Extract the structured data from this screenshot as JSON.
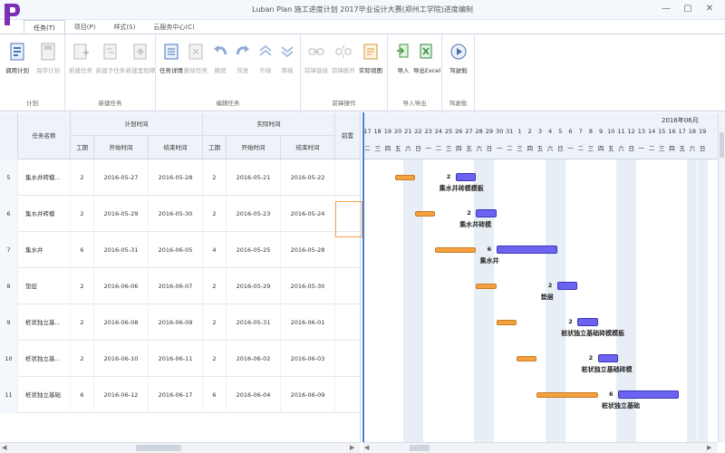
{
  "window": {
    "title": "Luban Plan 施工进度计划 2017毕业设计大赛(郑州工学院)进度编制",
    "minimize": "—",
    "maximize": "▢",
    "close": "✕"
  },
  "tabs": [
    "任务(T)",
    "项目(P)",
    "样式(S)",
    "云服务中心(C)"
  ],
  "ribbon": {
    "groups": [
      {
        "label": "计划",
        "buttons": [
          {
            "label": "调用计划",
            "icon": "open-plan-icon",
            "enabled": true
          },
          {
            "label": "保存计划",
            "icon": "save-plan-icon",
            "enabled": false
          }
        ]
      },
      {
        "label": "新建任务",
        "buttons": [
          {
            "label": "新建任务",
            "icon": "new-task-icon",
            "enabled": false
          },
          {
            "label": "新建子任务",
            "icon": "new-subtask-icon",
            "enabled": false
          },
          {
            "label": "新建里程碑",
            "icon": "new-milestone-icon",
            "enabled": false
          }
        ]
      },
      {
        "label": "编辑任务",
        "buttons": [
          {
            "label": "任务详情",
            "icon": "task-detail-icon",
            "enabled": true
          },
          {
            "label": "删除任务",
            "icon": "delete-task-icon",
            "enabled": false
          },
          {
            "label": "撤销",
            "icon": "undo-icon",
            "enabled": false
          },
          {
            "label": "恢复",
            "icon": "redo-icon",
            "enabled": false
          },
          {
            "label": "升级",
            "icon": "upgrade-icon",
            "enabled": false
          },
          {
            "label": "降级",
            "icon": "downgrade-icon",
            "enabled": false
          }
        ]
      },
      {
        "label": "前锋操作",
        "buttons": [
          {
            "label": "前锋链接",
            "icon": "link-icon",
            "enabled": false
          },
          {
            "label": "前锋断开",
            "icon": "unlink-icon",
            "enabled": false
          },
          {
            "label": "实际视图",
            "icon": "actual-view-icon",
            "enabled": true
          }
        ]
      },
      {
        "label": "导入导出",
        "buttons": [
          {
            "label": "导入",
            "icon": "import-icon",
            "enabled": true
          },
          {
            "label": "导出Excel",
            "icon": "export-excel-icon",
            "enabled": true
          }
        ]
      },
      {
        "label": "驾驶舱",
        "buttons": [
          {
            "label": "驾驶舱",
            "icon": "cockpit-icon",
            "enabled": true
          }
        ]
      }
    ]
  },
  "table": {
    "headers": {
      "task_name": "任务名称",
      "plan_time": "计划时间",
      "actual_time": "实际时间",
      "duration": "工期",
      "start": "开始时间",
      "end": "结束时间",
      "front": "前置"
    },
    "rows": [
      {
        "id": "5",
        "name": "集水井砖模...",
        "plan_dur": "2",
        "plan_start": "2016-05-27",
        "plan_end": "2016-05-28",
        "act_dur": "2",
        "act_start": "2016-05-21",
        "act_end": "2016-05-22"
      },
      {
        "id": "6",
        "name": "集水井砖模",
        "plan_dur": "2",
        "plan_start": "2016-05-29",
        "plan_end": "2016-05-30",
        "act_dur": "2",
        "act_start": "2016-05-23",
        "act_end": "2016-05-24"
      },
      {
        "id": "7",
        "name": "集水井",
        "plan_dur": "6",
        "plan_start": "2016-05-31",
        "plan_end": "2016-06-05",
        "act_dur": "4",
        "act_start": "2016-05-25",
        "act_end": "2016-05-28"
      },
      {
        "id": "8",
        "name": "垫层",
        "plan_dur": "2",
        "plan_start": "2016-06-06",
        "plan_end": "2016-06-07",
        "act_dur": "2",
        "act_start": "2016-05-29",
        "act_end": "2016-05-30"
      },
      {
        "id": "9",
        "name": "桩状独立基...",
        "plan_dur": "2",
        "plan_start": "2016-06-08",
        "plan_end": "2016-06-09",
        "act_dur": "2",
        "act_start": "2016-05-31",
        "act_end": "2016-06-01"
      },
      {
        "id": "10",
        "name": "桩状独立基...",
        "plan_dur": "2",
        "plan_start": "2016-06-10",
        "plan_end": "2016-06-11",
        "act_dur": "2",
        "act_start": "2016-06-02",
        "act_end": "2016-06-03"
      },
      {
        "id": "11",
        "name": "桩状独立基础",
        "plan_dur": "6",
        "plan_start": "2016-06-12",
        "plan_end": "2016-06-17",
        "act_dur": "6",
        "act_start": "2016-06-04",
        "act_end": "2016-06-09"
      }
    ]
  },
  "gantt": {
    "month_label": "2016年06月",
    "days": [
      "17",
      "18",
      "19",
      "20",
      "21",
      "22",
      "23",
      "24",
      "25",
      "26",
      "27",
      "28",
      "29",
      "30",
      "31",
      "1",
      "2",
      "3",
      "4",
      "5",
      "6",
      "7",
      "8",
      "9",
      "10",
      "11",
      "12",
      "13",
      "14",
      "15",
      "16",
      "17",
      "18",
      "19"
    ],
    "weekdays": [
      "二",
      "三",
      "四",
      "五",
      "六",
      "日",
      "一",
      "二",
      "三",
      "四",
      "五",
      "六",
      "日",
      "一",
      "二",
      "三",
      "四",
      "五",
      "六",
      "日",
      "一",
      "二",
      "三",
      "四",
      "五",
      "六",
      "日",
      "一",
      "二",
      "三",
      "四",
      "五",
      "六",
      "日"
    ],
    "bars": [
      {
        "plan_start": 3,
        "plan_len": 2,
        "actual_start": 9,
        "actual_len": 2,
        "num": "2",
        "name": "集水井砖模模板"
      },
      {
        "plan_start": 5,
        "plan_len": 2,
        "actual_start": 11,
        "actual_len": 2,
        "num": "2",
        "name": "集水井砖模"
      },
      {
        "plan_start": 7,
        "plan_len": 4,
        "actual_start": 13,
        "actual_len": 6,
        "num": "6",
        "name": "集水井"
      },
      {
        "plan_start": 11,
        "plan_len": 2,
        "actual_start": 19,
        "actual_len": 2,
        "num": "2",
        "name": "垫层"
      },
      {
        "plan_start": 13,
        "plan_len": 2,
        "actual_start": 21,
        "actual_len": 2,
        "num": "2",
        "name": "桩状独立基础砖模模板"
      },
      {
        "plan_start": 15,
        "plan_len": 2,
        "actual_start": 23,
        "actual_len": 2,
        "num": "2",
        "name": "桩状独立基础砖模"
      },
      {
        "plan_start": 17,
        "plan_len": 6,
        "actual_start": 25,
        "actual_len": 6,
        "num": "6",
        "name": "桩状独立基础"
      }
    ]
  },
  "colors": {
    "plan_bar": "#f4a13f",
    "actual_bar": "#6c63f0",
    "today_line": "#4a7fd6",
    "accent": "#7b2fb5"
  }
}
